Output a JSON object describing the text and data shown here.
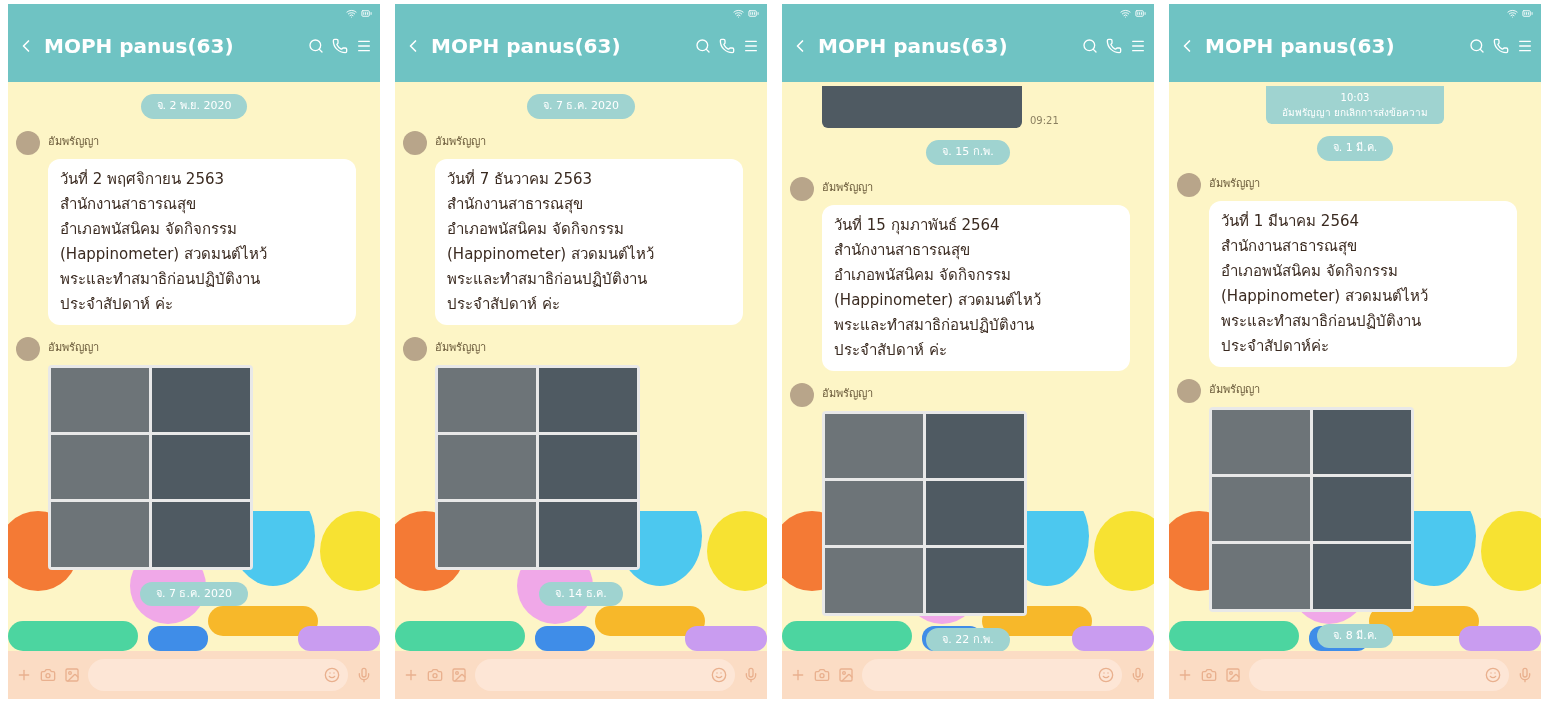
{
  "phones": [
    {
      "title": "MOPH panus(63)",
      "items": [
        {
          "kind": "date",
          "text": "จ. 2 พ.ย. 2020"
        },
        {
          "kind": "message",
          "sender": "อัมพรัญญา",
          "lines": [
            "วันที่ 2 พฤศจิกายน 2563",
            "สำนักงานสาธารณสุข",
            "อำเภอพนัสนิคม จัดกิจกรรม",
            "(Happinometer) สวดมนต์ไหว้",
            "พระและทำสมาธิก่อนปฏิบัติงาน",
            "ประจำสัปดาห์ ค่ะ"
          ]
        },
        {
          "kind": "photo",
          "sender": "อัมพรัญญา"
        },
        {
          "kind": "date",
          "text": "จ. 7 ธ.ค. 2020"
        }
      ]
    },
    {
      "title": "MOPH panus(63)",
      "items": [
        {
          "kind": "date",
          "text": "จ. 7 ธ.ค. 2020"
        },
        {
          "kind": "message",
          "sender": "อัมพรัญญา",
          "lines": [
            "วันที่ 7 ธันวาคม 2563",
            "สำนักงานสาธารณสุข",
            "อำเภอพนัสนิคม จัดกิจกรรม",
            "(Happinometer) สวดมนต์ไหว้",
            "พระและทำสมาธิก่อนปฏิบัติงาน",
            "ประจำสัปดาห์ ค่ะ"
          ]
        },
        {
          "kind": "photo",
          "sender": "อัมพรัญญา"
        },
        {
          "kind": "date",
          "text": "จ. 14 ธ.ค."
        }
      ]
    },
    {
      "title": "MOPH panus(63)",
      "items": [
        {
          "kind": "photo_top",
          "time": "09:21"
        },
        {
          "kind": "date",
          "text": "จ. 15 ก.พ."
        },
        {
          "kind": "message",
          "sender": "อัมพรัญญา",
          "lines": [
            "วันที่ 15 กุมภาพันธ์ 2564",
            "สำนักงานสาธารณสุข",
            "อำเภอพนัสนิคม จัดกิจกรรม",
            "(Happinometer) สวดมนต์ไหว้",
            "พระและทำสมาธิก่อนปฏิบัติงาน",
            "ประจำสัปดาห์ ค่ะ"
          ]
        },
        {
          "kind": "photo",
          "sender": "อัมพรัญญา"
        },
        {
          "kind": "date",
          "text": "จ. 22 ก.พ."
        }
      ]
    },
    {
      "title": "MOPH panus(63)",
      "items": [
        {
          "kind": "notice",
          "time": "10:03",
          "text": "อัมพรัญญา ยกเลิกการส่งข้อความ"
        },
        {
          "kind": "date",
          "text": "จ. 1 มี.ค."
        },
        {
          "kind": "message",
          "sender": "อัมพรัญญา",
          "lines": [
            "วันที่ 1 มีนาคม 2564",
            "สำนักงานสาธารณสุข",
            "อำเภอพนัสนิคม จัดกิจกรรม",
            "(Happinometer) สวดมนต์ไหว้",
            "พระและทำสมาธิก่อนปฏิบัติงาน",
            "ประจำสัปดาห์ค่ะ"
          ]
        },
        {
          "kind": "photo",
          "sender": "อัมพรัญญา"
        },
        {
          "kind": "date",
          "text": "จ. 8 มี.ค."
        }
      ]
    }
  ]
}
